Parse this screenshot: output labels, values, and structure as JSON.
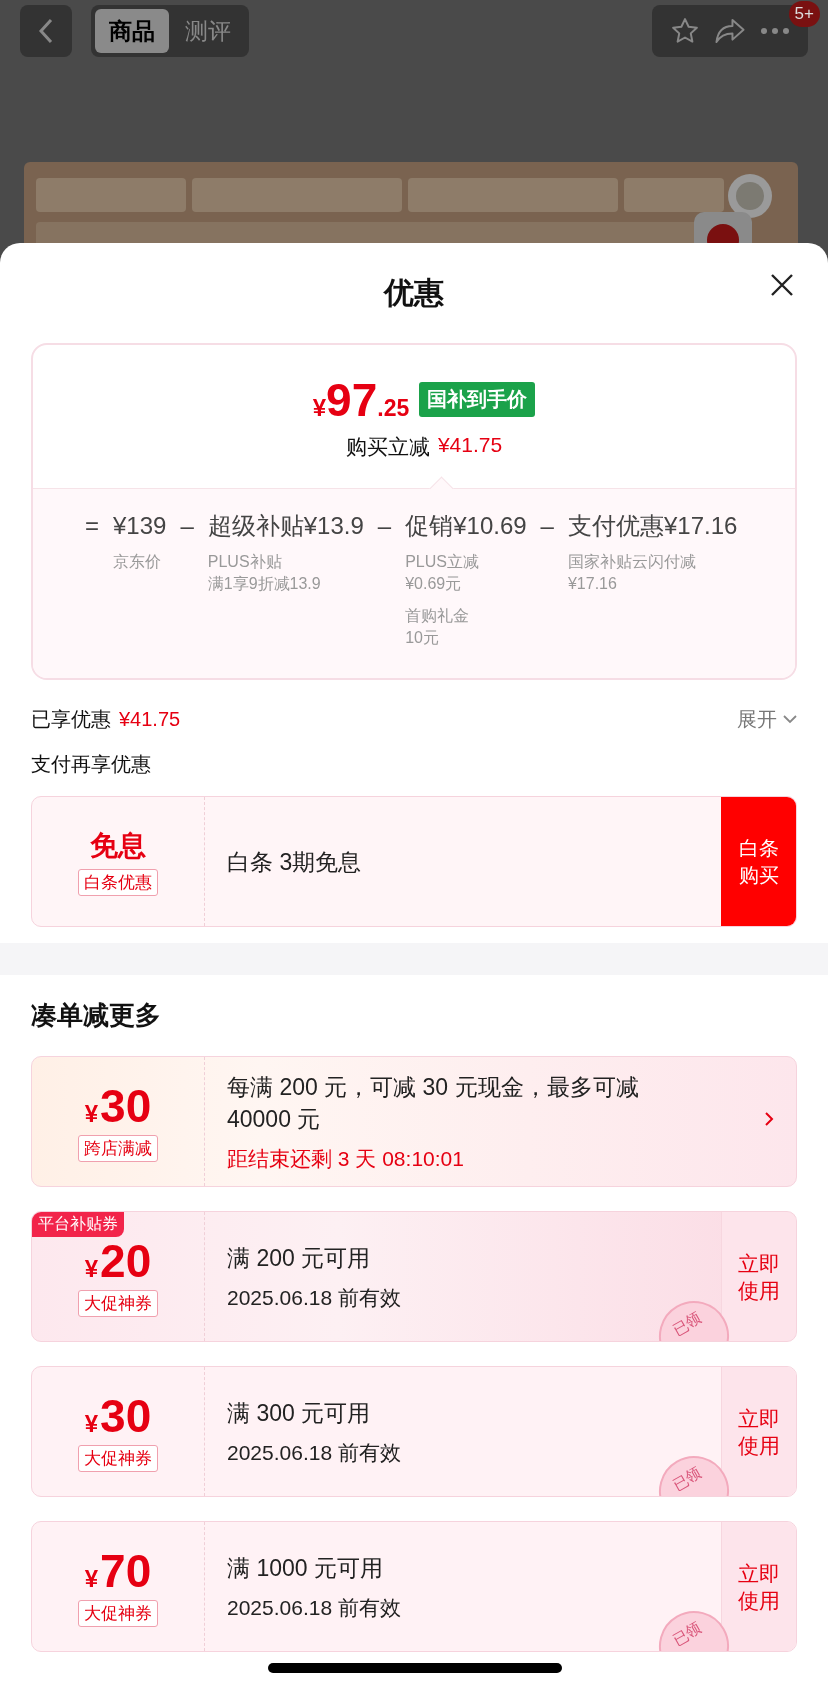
{
  "top_bar": {
    "tabs": [
      {
        "label": "商品",
        "selected": true
      },
      {
        "label": "测评",
        "selected": false
      }
    ],
    "badge": "5+"
  },
  "sheet": {
    "title": "优惠"
  },
  "price_card": {
    "currency": "¥",
    "integer": "97",
    "decimal": ".25",
    "tag": "国补到手价",
    "saving_label": "购买立减",
    "saving_value": "¥41.75",
    "breakdown": [
      {
        "operator": "=",
        "heading": "¥139",
        "notes": [
          [
            "京东价"
          ]
        ]
      },
      {
        "operator": "–",
        "heading": "超级补贴¥13.9",
        "notes": [
          [
            "PLUS补贴",
            "满1享9折减13.9"
          ]
        ]
      },
      {
        "operator": "–",
        "heading": "促销¥10.69",
        "notes": [
          [
            "PLUS立减",
            "¥0.69元"
          ],
          [
            "首购礼金",
            "10元"
          ]
        ]
      },
      {
        "operator": "–",
        "heading": "支付优惠¥17.16",
        "notes": [
          [
            "国家补贴云闪付减",
            "¥17.16"
          ]
        ]
      }
    ]
  },
  "applied": {
    "label": "已享优惠",
    "value": "¥41.75",
    "toggle": "展开",
    "expanded": false
  },
  "pay_section": {
    "title": "支付再享优惠",
    "offer": {
      "badge_title": "免息",
      "badge_label": "白条优惠",
      "text": "白条 3期免息",
      "button": "白条购买"
    }
  },
  "bundle": {
    "title": "凑单减更多",
    "coupons": [
      {
        "kind": "promo",
        "currency": "¥",
        "amount": "30",
        "label": "跨店满减",
        "text": "每满 200 元，可减 30 元现金，最多可减 40000 元",
        "countdown": "距结束还剩 3 天 08:10:01"
      },
      {
        "kind": "voucher",
        "ribbon": "平台补贴券",
        "currency": "¥",
        "amount": "20",
        "label": "大促神券",
        "text": "满 200 元可用",
        "validity": "2025.06.18 前有效",
        "action": "立即使用",
        "stamp": "已领"
      },
      {
        "kind": "voucher",
        "currency": "¥",
        "amount": "30",
        "label": "大促神券",
        "text": "满 300 元可用",
        "validity": "2025.06.18 前有效",
        "action": "立即使用",
        "stamp": "已领"
      },
      {
        "kind": "voucher",
        "currency": "¥",
        "amount": "70",
        "label": "大促神券",
        "text": "满 1000 元可用",
        "validity": "2025.06.18 前有效",
        "action": "立即使用",
        "stamp": "已领"
      }
    ]
  }
}
